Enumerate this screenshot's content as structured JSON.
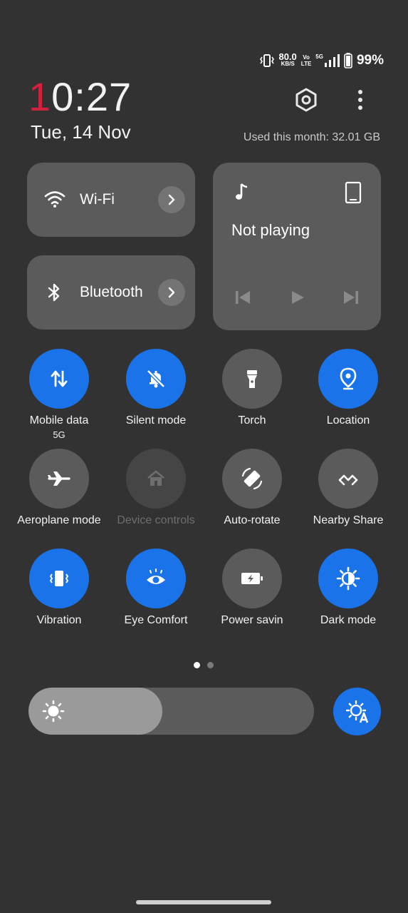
{
  "status_bar": {
    "speed_value": "80.0",
    "speed_unit": "KB/S",
    "volte_top": "Vo",
    "volte_bottom": "LTE",
    "network": "5G",
    "battery_percent": "99%"
  },
  "header": {
    "clock_first": "1",
    "clock_rest": "0:27",
    "date": "Tue, 14 Nov",
    "usage": "Used this month: 32.01 GB",
    "settings_icon": "settings-hex-icon",
    "more_icon": "more-vertical-icon"
  },
  "tiles": {
    "wifi": {
      "label": "Wi-Fi",
      "icon": "wifi-icon"
    },
    "bluetooth": {
      "label": "Bluetooth",
      "icon": "bluetooth-icon"
    }
  },
  "media": {
    "title": "Not playing",
    "music_icon": "music-note-icon",
    "device_icon": "phone-device-icon",
    "controls": [
      "previous-icon",
      "play-icon",
      "next-icon"
    ]
  },
  "quick_settings": [
    {
      "label": "Mobile data",
      "sub": "5G",
      "state": "on",
      "icon": "mobile-data-icon"
    },
    {
      "label": "Silent mode",
      "sub": "",
      "state": "on",
      "icon": "bell-off-icon"
    },
    {
      "label": "Torch",
      "sub": "",
      "state": "off",
      "icon": "torch-icon"
    },
    {
      "label": "Location",
      "sub": "",
      "state": "on",
      "icon": "location-pin-icon"
    },
    {
      "label": "Aeroplane mode",
      "sub": "",
      "state": "off",
      "icon": "airplane-icon"
    },
    {
      "label": "Device controls",
      "sub": "",
      "state": "disabled",
      "icon": "home-icon"
    },
    {
      "label": "Auto-rotate",
      "sub": "",
      "state": "off",
      "icon": "auto-rotate-icon"
    },
    {
      "label": "Nearby Share",
      "sub": "",
      "state": "off",
      "icon": "nearby-share-icon"
    },
    {
      "label": "Vibration",
      "sub": "",
      "state": "on",
      "icon": "vibration-icon"
    },
    {
      "label": "Eye Comfort",
      "sub": "",
      "state": "on",
      "icon": "eye-icon"
    },
    {
      "label": "Power savin",
      "sub": "",
      "state": "off",
      "icon": "battery-saver-icon"
    },
    {
      "label": "Dark mode",
      "sub": "",
      "state": "on",
      "icon": "dark-mode-icon"
    }
  ],
  "pager": {
    "pages": 2,
    "active": 1
  },
  "brightness": {
    "level_percent": 47,
    "icon": "brightness-icon",
    "auto_icon": "auto-brightness-icon"
  },
  "colors": {
    "accent": "#1a73e8",
    "clock_accent": "#d0213f",
    "tile": "#5b5b5b",
    "background": "#323232"
  }
}
